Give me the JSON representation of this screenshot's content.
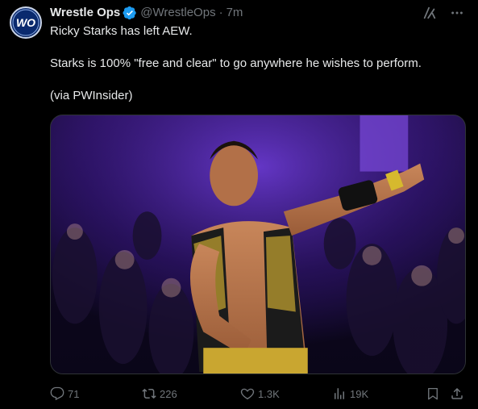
{
  "author": {
    "name": "Wrestle Ops",
    "handle": "@WrestleOps",
    "time": "7m",
    "avatar_text": "WO"
  },
  "tweet": {
    "line1": "Ricky Starks has left AEW.",
    "line2": "Starks is 100% \"free and clear\" to go anywhere he wishes to perform.",
    "line3": "(via PWInsider)"
  },
  "icons": {
    "verified": "verified-badge-icon",
    "grok": "grok-icon",
    "more": "more-icon",
    "reply": "reply-icon",
    "retweet": "retweet-icon",
    "like": "heart-icon",
    "views": "views-icon",
    "bookmark": "bookmark-icon",
    "share": "share-icon"
  },
  "stats": {
    "replies": "71",
    "retweets": "226",
    "likes": "1.3K",
    "views": "19K"
  },
  "colors": {
    "background": "#000000",
    "text": "#e7e9ea",
    "muted": "#71767b",
    "verified": "#1d9bf0"
  }
}
